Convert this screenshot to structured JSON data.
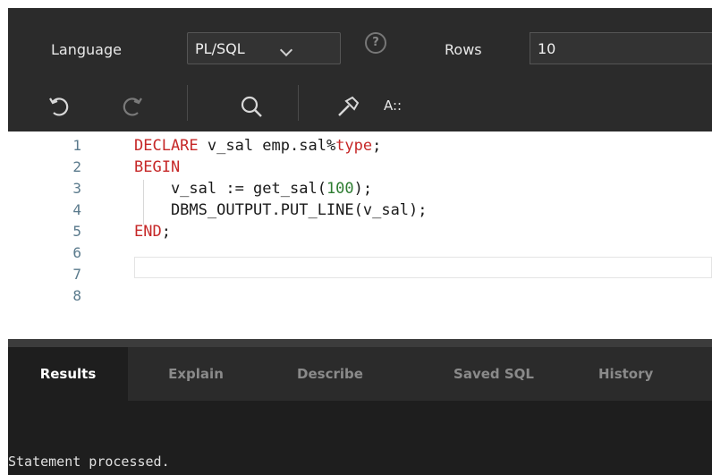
{
  "toolbar": {
    "language_label": "Language",
    "language_value": "PL/SQL",
    "rows_label": "Rows",
    "rows_value": "10",
    "icons": [
      "undo-icon",
      "redo-icon",
      "search-icon",
      "format-hammer-icon",
      "autocomplete-icon"
    ],
    "autocomplete_text": "A::"
  },
  "editor": {
    "lines": [
      {
        "num": "1",
        "parts": [
          {
            "t": "DECLARE",
            "k": "kw"
          },
          {
            "t": " v_sal emp.sal%"
          },
          {
            "t": "type",
            "k": "kw"
          },
          {
            "t": ";"
          }
        ]
      },
      {
        "num": "2",
        "parts": [
          {
            "t": "BEGIN",
            "k": "kw"
          }
        ]
      },
      {
        "num": "3",
        "parts": [
          {
            "t": "    v_sal := get_sal("
          },
          {
            "t": "100",
            "k": "num"
          },
          {
            "t": ");"
          }
        ]
      },
      {
        "num": "4",
        "parts": [
          {
            "t": "    DBMS_OUTPUT.PUT_LINE(v_sal);"
          }
        ]
      },
      {
        "num": "5",
        "parts": [
          {
            "t": "END",
            "k": "kw"
          },
          {
            "t": ";"
          }
        ]
      },
      {
        "num": "6",
        "parts": []
      },
      {
        "num": "7",
        "parts": []
      },
      {
        "num": "8",
        "parts": []
      }
    ]
  },
  "results": {
    "tabs": [
      "Results",
      "Explain",
      "Describe",
      "Saved SQL",
      "History"
    ],
    "active_tab": "Results",
    "output": "Statement processed."
  },
  "colors": {
    "toolbar_bg": "#2b2b2b",
    "editor_bg": "#ffffff",
    "keyword": "#c62828",
    "number": "#2e7d32",
    "line_number": "#5a7a8c"
  }
}
